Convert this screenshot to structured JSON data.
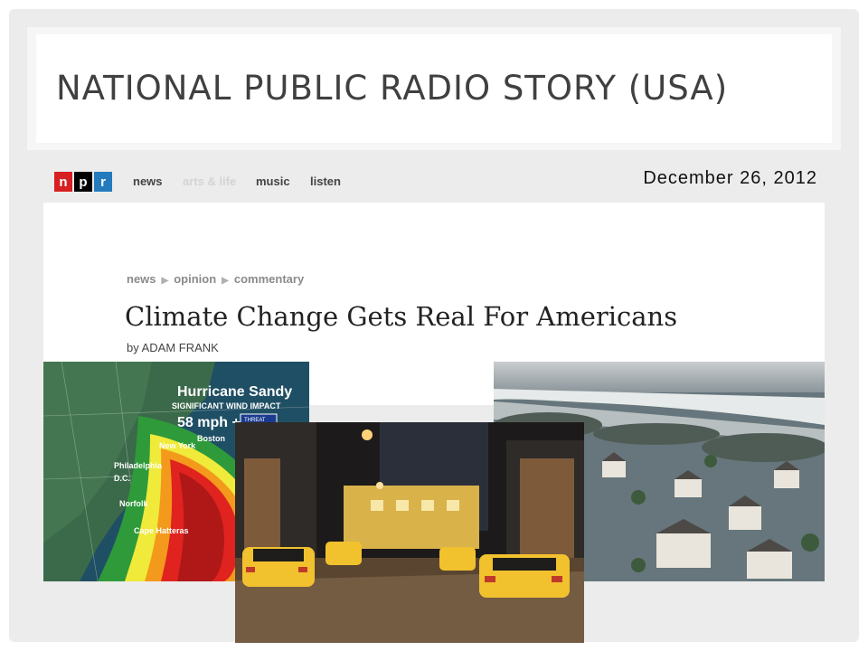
{
  "slide": {
    "title": "NATIONAL PUBLIC RADIO STORY (USA)",
    "date": "December 26, 2012"
  },
  "npr": {
    "logo": [
      "n",
      "p",
      "r"
    ],
    "logo_colors": [
      "#d62021",
      "#000000",
      "#237bbd"
    ],
    "nav": [
      "news",
      "arts & life",
      "music",
      "listen"
    ]
  },
  "article": {
    "breadcrumb": [
      "news",
      "opinion",
      "commentary"
    ],
    "headline": "Climate Change Gets Real For Americans",
    "byline": "by ADAM FRANK"
  },
  "hurricane_map": {
    "title": "Hurricane Sandy",
    "subtitle": "SIGNIFICANT WIND IMPACT",
    "wind": "58 mph +",
    "threat": "THREAT",
    "cities": [
      "Boston",
      "New York",
      "Philadelphia",
      "D.C.",
      "Norfolk",
      "Cape Hatteras"
    ]
  }
}
